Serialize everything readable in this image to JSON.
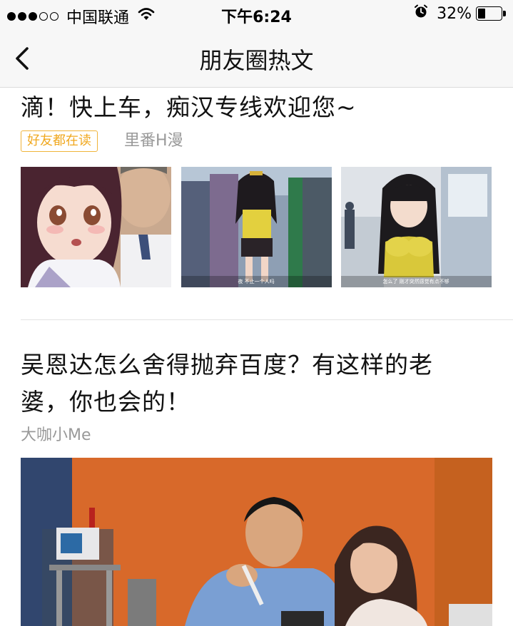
{
  "status_bar": {
    "carrier": "中国联通",
    "time": "下午6:24",
    "battery_percent_text": "32%",
    "battery_level": 0.32,
    "signal_bars_filled": 3,
    "signal_bars_total": 5,
    "icons": [
      "wifi-icon",
      "alarm-icon",
      "battery-icon"
    ]
  },
  "nav": {
    "title": "朋友圈热文",
    "back_icon": "chevron-left-icon"
  },
  "articles": [
    {
      "title": "滴！快上车，痴汉专线欢迎您~",
      "badge": "好友都在读",
      "source": "里番H漫",
      "thumbnails": [
        {
          "caption": ""
        },
        {
          "caption": "夜 不止一个人吗"
        },
        {
          "caption": "怎么了 刚才突然感觉有点不够"
        }
      ]
    },
    {
      "title": "吴恩达怎么舍得抛弃百度？有这样的老婆，你也会的！",
      "source": "大咖小Me"
    }
  ],
  "colors": {
    "badge": "#f0a81f",
    "secondary_text": "#999999",
    "bar_bg": "#f7f7f7"
  }
}
